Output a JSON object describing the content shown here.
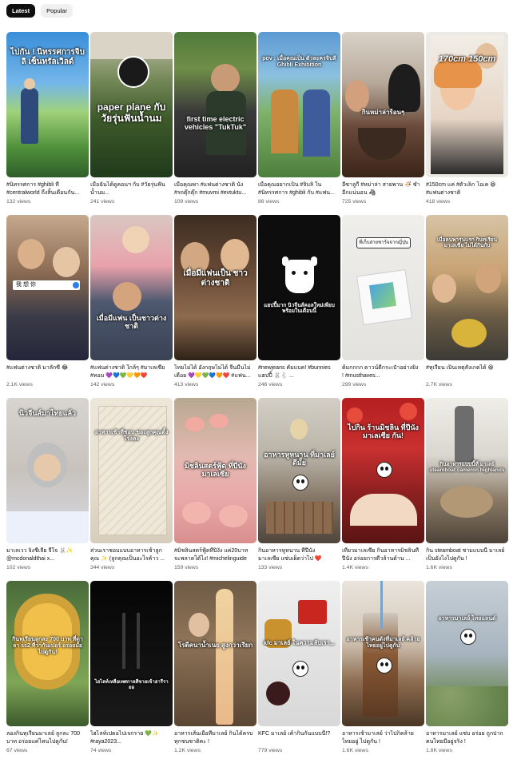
{
  "tabs": {
    "latest": "Latest",
    "popular": "Popular"
  },
  "videos": [
    {
      "caption": "#นิทรรศการ #ghibli ที่ #centralworld ถึงสิ้นเดือนกัน...",
      "views": "132 views",
      "overlay": "ไปกัน ! นิทรรศการจิบลิ เซ็นทรัลเวิลด์"
    },
    {
      "caption": "เมื่อฉันได้ดูคอนฯ กับ #วัยรุ่นฟันน้ำนม...",
      "views": "241 views",
      "overlay": "paper plane กับ วัยรุ่นฟันน้ำนม"
    },
    {
      "caption": "เมื่อคุณพา #แฟนต่างชาติ นั่ง #รถตุ๊กตุ๊ก #muvmi #evtuktu...",
      "views": "109 views",
      "overlay": "first time electric vehicles \"TukTuk\""
    },
    {
      "caption": "เมื่อคุณอยากเป็น #จิบลิ ใน #นิทรรศการ #ghibli กับ #แฟน...",
      "views": "86 views",
      "overlay": "pov : เมื่อคุณเป็น ตัวละครจิบลิ Ghibli Exhibition"
    },
    {
      "caption": "อี๋ซาลูกี้ #หม่าล่า สายพาน 🍜 ซ้ำอีกแน่นอน 🦓",
      "views": "725 views",
      "overlay": "กินหม่าล่าร้อนๆ"
    },
    {
      "caption": "#150cm แค่ #ตัวเล็ก โอเค 😆 #แฟนต่างชาติ",
      "views": "418 views",
      "overlay": "170cm 150cm"
    },
    {
      "caption": "#แฟนต่างชาติ มาลักซี 😂",
      "views": "2.1K views",
      "overlay": "我 想 你"
    },
    {
      "caption": "#แฟนต่างชาติ ใกล้ๆ #มาเลเซีย #ทอม 💜💙💚💛🧡❤️",
      "views": "142 views",
      "overlay": "เมื่อมีแฟน เป็นชาวต่างชาติ"
    },
    {
      "caption": "ไทยไม่ได้ อังกฤษไม่ได้ จีนมีนไม่เดือย 💜💛💚💙🧡❤️ #แฟน...",
      "views": "413 views",
      "overlay": "เมื่อมีแฟนเป็น ชาวต่างชาติ"
    },
    {
      "caption": "#newjeans คัมแบค! #bunnies แฮปปี้ 🐰🐇 ...",
      "views": "246 views",
      "overlay": "แฮปปี้มาก นิวจีนส์คอลใหม่เพียบ พร้อมในเดือนนี้"
    },
    {
      "caption": "ต้มกกกก ดาวน์ดีกระเป๋าอย่างยิ่ง ! #musthaves...",
      "views": "299 views",
      "overlay": "ที่เก็บสายชาร์จจากญี่ปุ่น"
    },
    {
      "caption": "#ทุเรียน เป็นเหตุสังเกตได้ 😆",
      "views": "2.7K views",
      "overlay": "เมื่อคนพารุ่นแรก กินทุเรียนมาเลเซีย ไม่ได้กินกับ"
    },
    {
      "caption": "มาเลเวว จิ่งชีเลีย จี้ใจ 🐰✨ @mcdonaldthai x...",
      "views": "102 views",
      "overlay": "นิวจีนส์มาไทยแล้ว"
    },
    {
      "caption": "ส่วนเราชอบแบบอาหารเช้าลูกคุณ ✨ (ลูกคุณเป็นอะไรค้าว ...",
      "views": "344 views",
      "overlay": "อาหารเช้าที่ชอบ ของลูกคุณตั้งโรงคะ"
    },
    {
      "caption": "#มิชลินสตร์ฟู้ดที่ปิงัง แค่20บาท จะพลาดได้ไง! #michelinguide",
      "views": "159 views",
      "overlay": "มิชลินสตร์ฟู้ด ที่ปีนัง มาเลเซีย"
    },
    {
      "caption": "กินอาหารหูหนาน ที่ปีนัง มาเลเซีย แซ่บเผ็ดว่าไป ❤️",
      "views": "133 views",
      "overlay": "อาหารหูหนาน ที่มาเลย์ ดีมั้ย"
    },
    {
      "caption": "เที่ยวมาเลเซีย กินอาหารมิชลินที่ปีนัง อร่อยการดีวล้านด้าน ...",
      "views": "1.4K views",
      "overlay": "ไปกิน ร้านมิชลิน ที่ปีนัง มาเลเซีย กัน!"
    },
    {
      "caption": "กิน steamboat ชามแบบนี้ มาเลย์ เป็นยังไงไปดูกัน !",
      "views": "1.6K views",
      "overlay": "กินอาหารแบบนี้ที่ มาเลย์ steamboat cameron highlands"
    },
    {
      "caption": "ลองกินทุเรียนมาเลย์ ลูกละ 700 บาท อร่อยแค่ไหนไปดูกัน!",
      "views": "67 views",
      "overlay": "กินทุเรียนลูกละ 700 บาท ที่ดาลา ss2 ที่ว่ากันเปอร์ อร่อยมั้ย ไปดูกัน!"
    },
    {
      "caption": "ไฮไลท์เปดอไปเจกราย 💚✨ #raya2023...",
      "views": "74 views",
      "overlay": "ไฮไลท์เหลือเทศกาลสีขายเข้าฮารีรายอ"
    },
    {
      "caption": "อาหารเส้นเยือที่มาเลย์ กินได้ครบ ทุกชนชาติคะ !",
      "views": "1.2K views",
      "overlay": "โรตีคนาน้ำเนย สูงกว่าเรียก"
    },
    {
      "caption": "KFC มาเลย์ เค้ากินกันแบบนี้!?",
      "views": "779 views",
      "overlay": "kfc มาเลย์ ในความลับเรา..."
    },
    {
      "caption": "อาหารเช้ามาเลย์ ว่าไปก็คล้ายไทยอยู่ ไปดูกัน !",
      "views": "1.6K views",
      "overlay": "อาหารเช้าคนดังที่มาเลย์ คล้ายไทยอยู่ไปดูกัน"
    },
    {
      "caption": "อาหารมาเลย์ แซ่บ อร่อย ถูกปาก คนไทยมีอยู่จริง !",
      "views": "1.8K views",
      "overlay": "อาหารมาเลย์ ไทยแลนด์"
    }
  ],
  "colors": {
    "chip_active": "#0f0f0f",
    "chip_inactive": "#f0f0f0",
    "views_text": "#606060"
  }
}
